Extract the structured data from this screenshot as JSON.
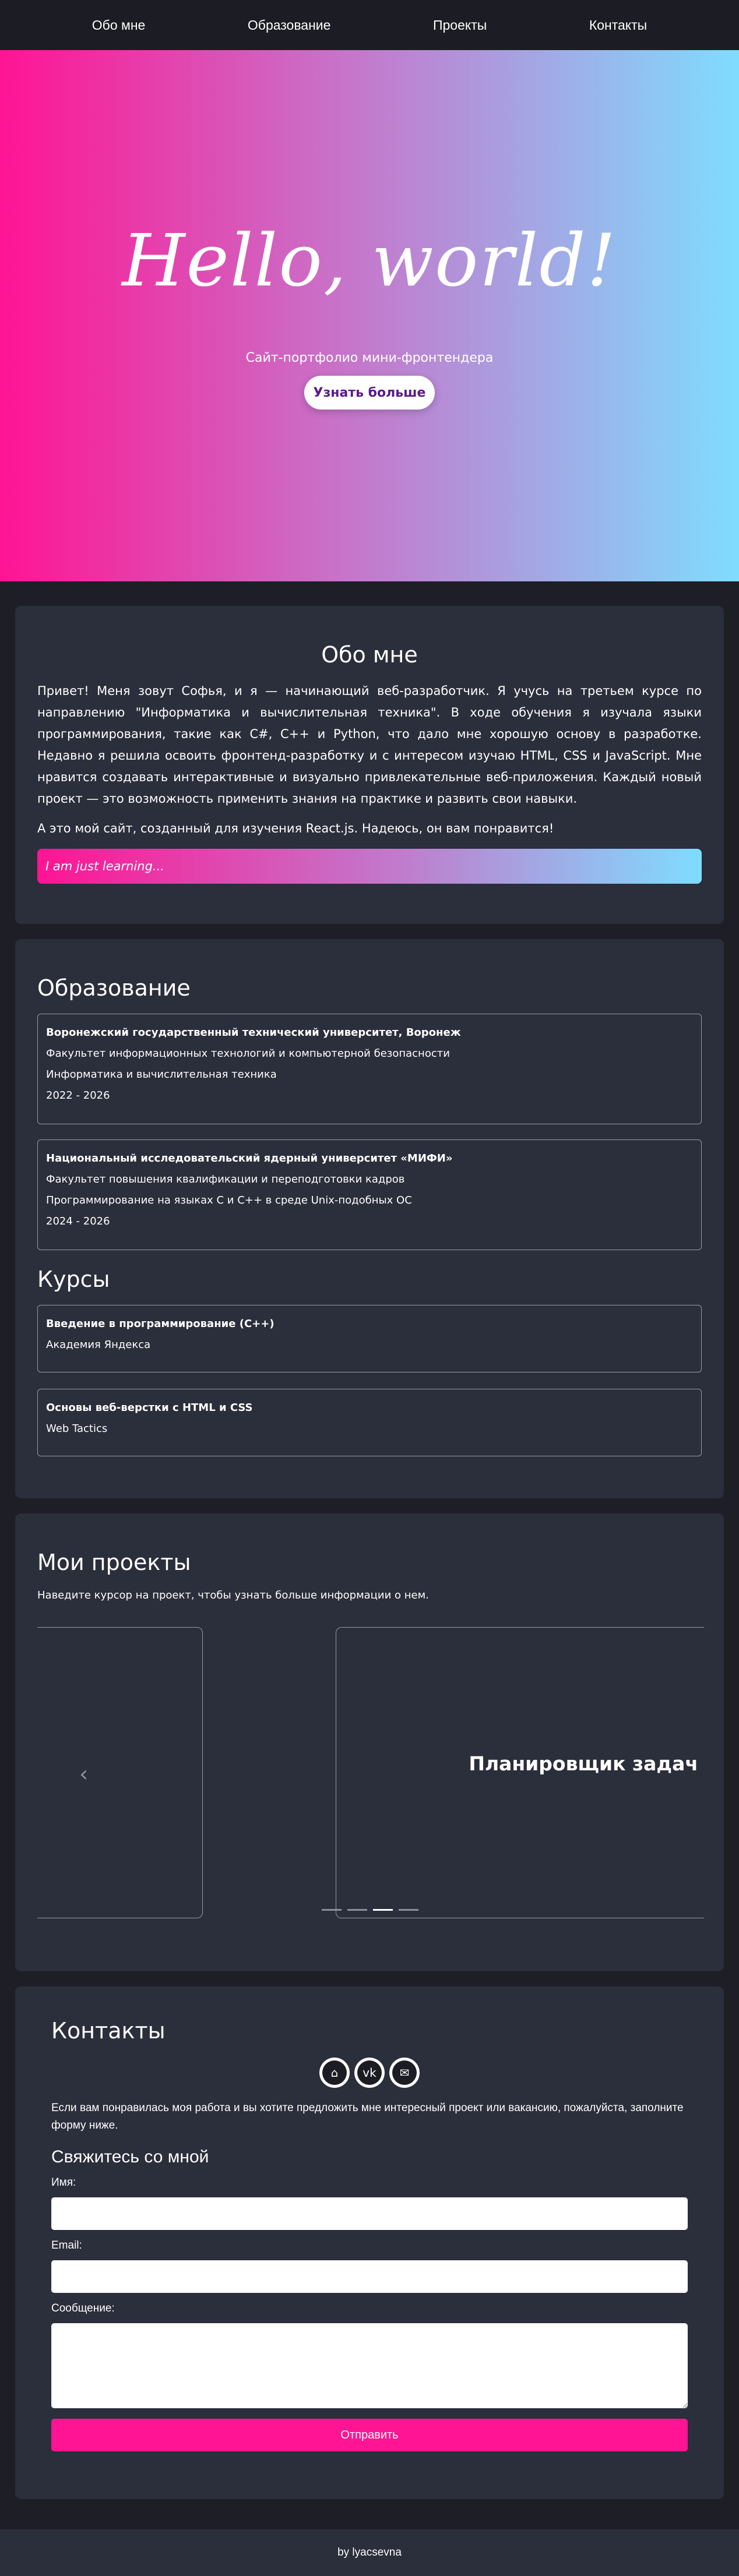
{
  "nav": {
    "items": [
      {
        "label": "Обо мне"
      },
      {
        "label": "Образование"
      },
      {
        "label": "Проекты"
      },
      {
        "label": "Контакты"
      }
    ]
  },
  "hero": {
    "title": "Hello, world!",
    "subtitle": "Сайт-портфолио мини-фронтендера",
    "button_label": "Узнать больше"
  },
  "about": {
    "title": "Обо мне",
    "paragraphs": [
      "Привет! Меня зовут Софья, и я — начинающий веб-разработчик. Я учусь на третьем курсе по направлению \"Информатика и вычислительная техника\". В ходе обучения я изучала языки программирования, такие как C#, C++ и Python, что дало мне хорошую основу в разработке. Недавно я решила освоить фронтенд-разработку и с интересом изучаю HTML, CSS и JavaScript. Мне нравится создавать интерактивные и визуально привлекательные веб-приложения. Каждый новый проект — это возможность применить знания на практике и развить свои навыки.",
      "А это мой сайт, созданный для изучения React.js. Надеюсь, он вам понравится!"
    ],
    "learning_text": "I am just learning..."
  },
  "education": {
    "title": "Образование",
    "items": [
      {
        "name": "Воронежский государственный технический университет, Воронеж",
        "faculty": "Факультет информационных технологий и компьютерной безопасности",
        "program": "Информатика и вычислительная техника",
        "years": "2022 - 2026"
      },
      {
        "name": "Национальный исследовательский ядерный университет «МИФИ»",
        "faculty": "Факультет повышения квалификации и переподготовки кадров",
        "program": "Программирование на языках С и С++ в среде Unix-подобных ОС",
        "years": "2024 - 2026"
      }
    ],
    "courses_title": "Курсы",
    "courses": [
      {
        "name": "Введение в программирование (C++)",
        "org": "Академия Яндекса"
      },
      {
        "name": "Основы веб-верстки с HTML и CSS",
        "org": "Web Tactics"
      }
    ]
  },
  "projects": {
    "title": "Мои проекты",
    "hint": "Наведите курсор на проект, чтобы узнать больше информации о нем.",
    "slide_title": "Планировщик задач",
    "arrow_glyph": "‹",
    "dots_count": 4,
    "active_dot": 2
  },
  "contacts": {
    "title": "Контакты",
    "socials": [
      {
        "icon": "github-icon",
        "glyph": "⌂"
      },
      {
        "icon": "vk-icon",
        "glyph": "vk"
      },
      {
        "icon": "mail-icon",
        "glyph": "✉"
      }
    ],
    "text": "Если вам понравилась моя работа и вы хотите предложить мне интересный проект или вакансию, пожалуйста, заполните форму ниже.",
    "form_title": "Свяжитесь со мной",
    "name_label": "Имя:",
    "email_label": "Email:",
    "message_label": "Сообщение:",
    "submit_label": "Отправить"
  },
  "footer": {
    "text": "by lyacsevna"
  },
  "colors": {
    "background": "#1e1f26",
    "card": "#2b2e3b",
    "accent": "#ff1493",
    "gradient_end": "#7fdcff"
  }
}
